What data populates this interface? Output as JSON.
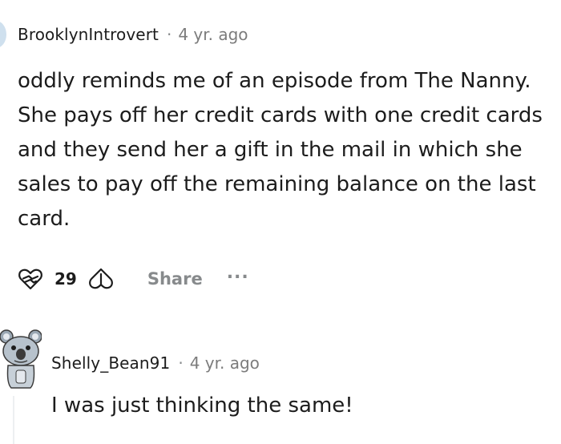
{
  "comments": [
    {
      "username": "BrooklynIntrovert",
      "separator": "·",
      "age": "4 yr. ago",
      "body": "oddly reminds me of an episode from The Nanny. She pays off her credit cards with one credit cards and they send her a gift in the mail in which she sales to pay off the remaining balance on the last card.",
      "actions": {
        "score": "29",
        "share_label": "Share",
        "more_label": "..."
      }
    },
    {
      "username": "Shelly_Bean91",
      "separator": "·",
      "age": "4 yr. ago",
      "body": "I was just thinking the same!"
    }
  ],
  "icons": {
    "upvote": "heart-upvote-icon",
    "downvote": "heart-downvote-icon",
    "more": "overflow-menu-icon",
    "avatar_2": "koala-snoo-avatar"
  },
  "colors": {
    "text": "#1c1c1c",
    "muted": "#878a8c",
    "thread_line": "#edeff1"
  }
}
